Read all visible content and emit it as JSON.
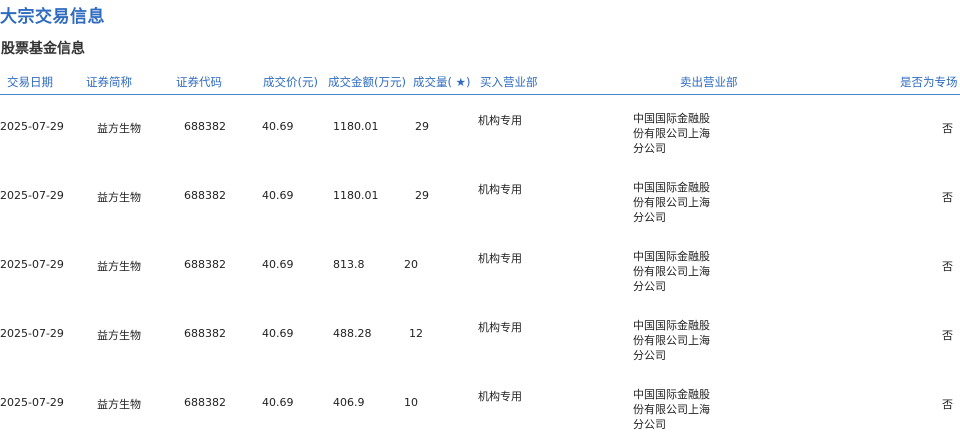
{
  "page": {
    "title": "大宗交易信息",
    "section_title": "股票基金信息"
  },
  "table": {
    "headers": {
      "date": "交易日期",
      "name": "证券简称",
      "code": "证券代码",
      "price": "成交价(元)",
      "amount": "成交金额(万元)",
      "volume": "成交量( ★)",
      "buyer": "买入营业部",
      "seller": "卖出营业部",
      "special": "是否为专场"
    },
    "rows": [
      {
        "date": "2025-07-29",
        "name": "益方生物",
        "code": "688382",
        "price": "40.69",
        "amount": "1180.01",
        "volume": "29",
        "buyer": "机构专用",
        "seller": "中国国际金融股份有限公司上海分公司",
        "special": "否"
      },
      {
        "date": "2025-07-29",
        "name": "益方生物",
        "code": "688382",
        "price": "40.69",
        "amount": "1180.01",
        "volume": "29",
        "buyer": "机构专用",
        "seller": "中国国际金融股份有限公司上海分公司",
        "special": "否"
      },
      {
        "date": "2025-07-29",
        "name": "益方生物",
        "code": "688382",
        "price": "40.69",
        "amount": "813.8",
        "volume": "20",
        "buyer": "机构专用",
        "seller": "中国国际金融股份有限公司上海分公司",
        "special": "否"
      },
      {
        "date": "2025-07-29",
        "name": "益方生物",
        "code": "688382",
        "price": "40.69",
        "amount": "488.28",
        "volume": "12",
        "buyer": "机构专用",
        "seller": "中国国际金融股份有限公司上海分公司",
        "special": "否"
      },
      {
        "date": "2025-07-29",
        "name": "益方生物",
        "code": "688382",
        "price": "40.69",
        "amount": "406.9",
        "volume": "10",
        "buyer": "机构专用",
        "seller": "中国国际金融股份有限公司上海分公司",
        "special": "否"
      }
    ]
  }
}
